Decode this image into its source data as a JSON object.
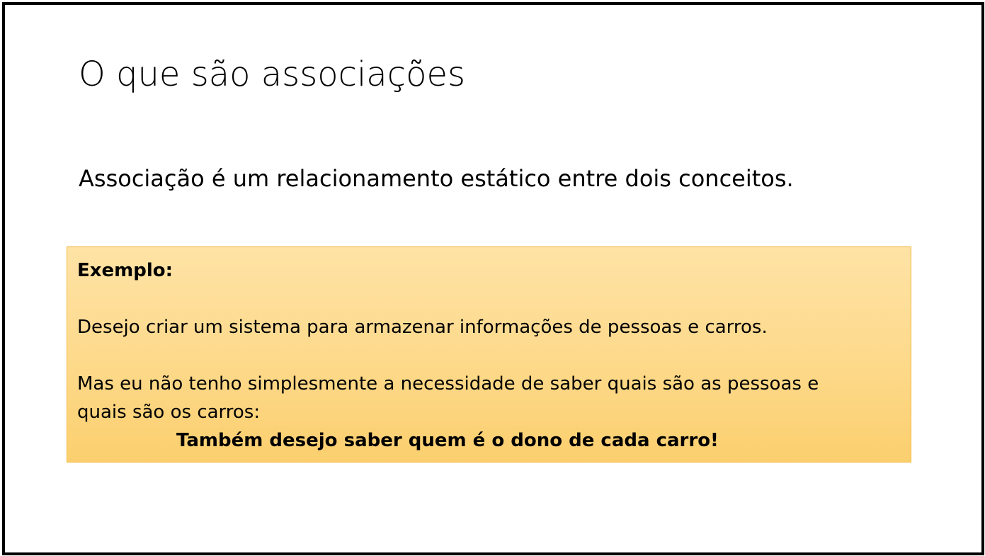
{
  "slide": {
    "title": "O que são associações",
    "definition": "Associação é um relacionamento estático entre dois conceitos.",
    "example": {
      "heading": "Exemplo:",
      "paragraph_1": "Desejo criar um sistema para armazenar informações de pessoas e carros.",
      "paragraph_2_line_1": "Mas eu não tenho simplesmente a necessidade de saber quais são as pessoas e",
      "paragraph_2_line_2": "quais são os carros:",
      "emphasis": "Também desejo saber quem é o dono de cada carro!"
    }
  },
  "colors": {
    "border": "#000000",
    "box_top": "#fee3a6",
    "box_bottom": "#fbcf6e",
    "box_border": "#f4b63a"
  }
}
